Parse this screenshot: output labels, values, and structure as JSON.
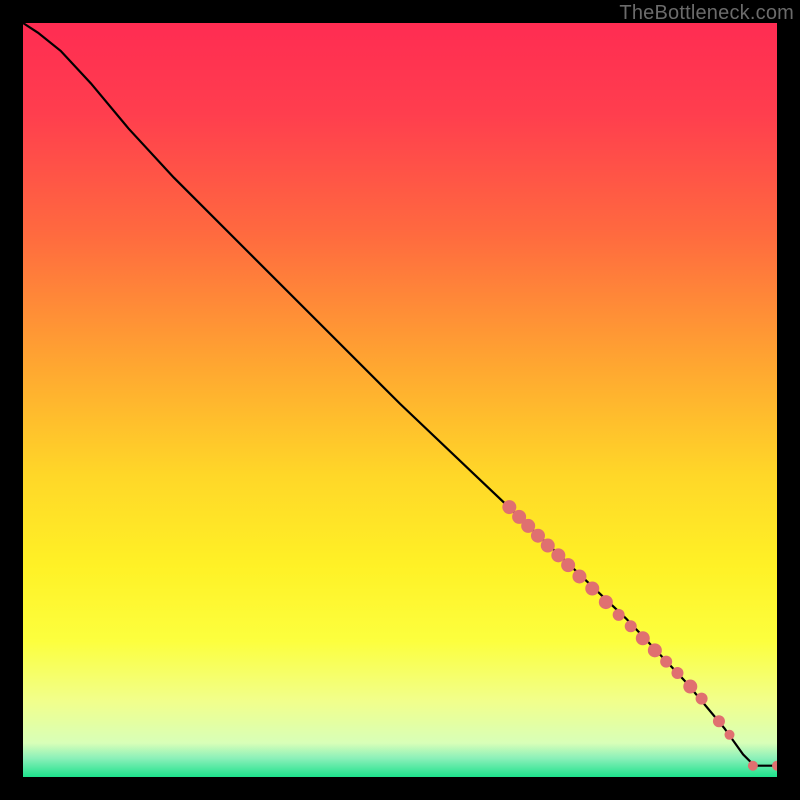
{
  "watermark": "TheBottleneck.com",
  "chart_data": {
    "type": "line",
    "title": "",
    "xlabel": "",
    "ylabel": "",
    "xlim": [
      0,
      100
    ],
    "ylim": [
      0,
      100
    ],
    "background_gradient_stops": [
      {
        "pct": 0.0,
        "color": "#FF2C52"
      },
      {
        "pct": 0.12,
        "color": "#FF3E4E"
      },
      {
        "pct": 0.28,
        "color": "#FF6A3F"
      },
      {
        "pct": 0.45,
        "color": "#FFA531"
      },
      {
        "pct": 0.6,
        "color": "#FFD728"
      },
      {
        "pct": 0.72,
        "color": "#FFF126"
      },
      {
        "pct": 0.82,
        "color": "#FCFF3E"
      },
      {
        "pct": 0.9,
        "color": "#F1FF8C"
      },
      {
        "pct": 0.955,
        "color": "#D8FFB8"
      },
      {
        "pct": 0.975,
        "color": "#8CF0B9"
      },
      {
        "pct": 1.0,
        "color": "#1DE28C"
      }
    ],
    "curve": [
      {
        "x": 0.0,
        "y": 100.0
      },
      {
        "x": 2.0,
        "y": 98.7
      },
      {
        "x": 5.0,
        "y": 96.3
      },
      {
        "x": 9.0,
        "y": 92.0
      },
      {
        "x": 14.0,
        "y": 86.0
      },
      {
        "x": 20.0,
        "y": 79.5
      },
      {
        "x": 30.0,
        "y": 69.5
      },
      {
        "x": 40.0,
        "y": 59.5
      },
      {
        "x": 50.0,
        "y": 49.5
      },
      {
        "x": 60.0,
        "y": 40.0
      },
      {
        "x": 70.0,
        "y": 30.5
      },
      {
        "x": 80.0,
        "y": 21.0
      },
      {
        "x": 88.0,
        "y": 12.5
      },
      {
        "x": 93.0,
        "y": 6.5
      },
      {
        "x": 95.5,
        "y": 3.0
      },
      {
        "x": 97.0,
        "y": 1.5
      },
      {
        "x": 100.0,
        "y": 1.5
      }
    ],
    "markers": [
      {
        "x": 64.5,
        "y": 35.8,
        "r": 7
      },
      {
        "x": 65.8,
        "y": 34.5,
        "r": 7
      },
      {
        "x": 67.0,
        "y": 33.3,
        "r": 7
      },
      {
        "x": 68.3,
        "y": 32.0,
        "r": 7
      },
      {
        "x": 69.6,
        "y": 30.7,
        "r": 7
      },
      {
        "x": 71.0,
        "y": 29.4,
        "r": 7
      },
      {
        "x": 72.3,
        "y": 28.1,
        "r": 7
      },
      {
        "x": 73.8,
        "y": 26.6,
        "r": 7
      },
      {
        "x": 75.5,
        "y": 25.0,
        "r": 7
      },
      {
        "x": 77.3,
        "y": 23.2,
        "r": 7
      },
      {
        "x": 79.0,
        "y": 21.5,
        "r": 6
      },
      {
        "x": 80.6,
        "y": 20.0,
        "r": 6
      },
      {
        "x": 82.2,
        "y": 18.4,
        "r": 7
      },
      {
        "x": 83.8,
        "y": 16.8,
        "r": 7
      },
      {
        "x": 85.3,
        "y": 15.3,
        "r": 6
      },
      {
        "x": 86.8,
        "y": 13.8,
        "r": 6
      },
      {
        "x": 88.5,
        "y": 12.0,
        "r": 7
      },
      {
        "x": 90.0,
        "y": 10.4,
        "r": 6
      },
      {
        "x": 92.3,
        "y": 7.4,
        "r": 6
      },
      {
        "x": 93.7,
        "y": 5.6,
        "r": 5
      },
      {
        "x": 96.8,
        "y": 1.5,
        "r": 5
      },
      {
        "x": 100.0,
        "y": 1.5,
        "r": 5
      }
    ],
    "marker_color": "#E07070",
    "curve_color": "#000000"
  }
}
